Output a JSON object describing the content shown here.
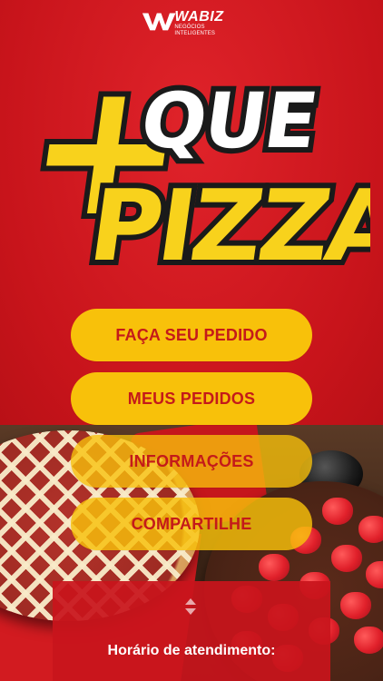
{
  "brand": {
    "provider_name": "WABIZ",
    "provider_tagline": "NEGÓCIOS INTELIGENTES",
    "app_logo_plus": "+",
    "app_logo_line1": "QUE",
    "app_logo_line2": "PIZZA"
  },
  "menu": {
    "items": [
      {
        "label": "FAÇA SEU PEDIDO"
      },
      {
        "label": "MEUS PEDIDOS"
      },
      {
        "label": "INFORMAÇÕES"
      },
      {
        "label": "COMPARTILHE"
      }
    ]
  },
  "footer": {
    "hours_label": "Horário de atendimento:",
    "expand_icon": "chevron-up-down-icon"
  },
  "colors": {
    "background": "#d1171e",
    "button": "#f8c10a",
    "button_text": "#c41a1a",
    "logo_yellow": "#f8d21c"
  }
}
